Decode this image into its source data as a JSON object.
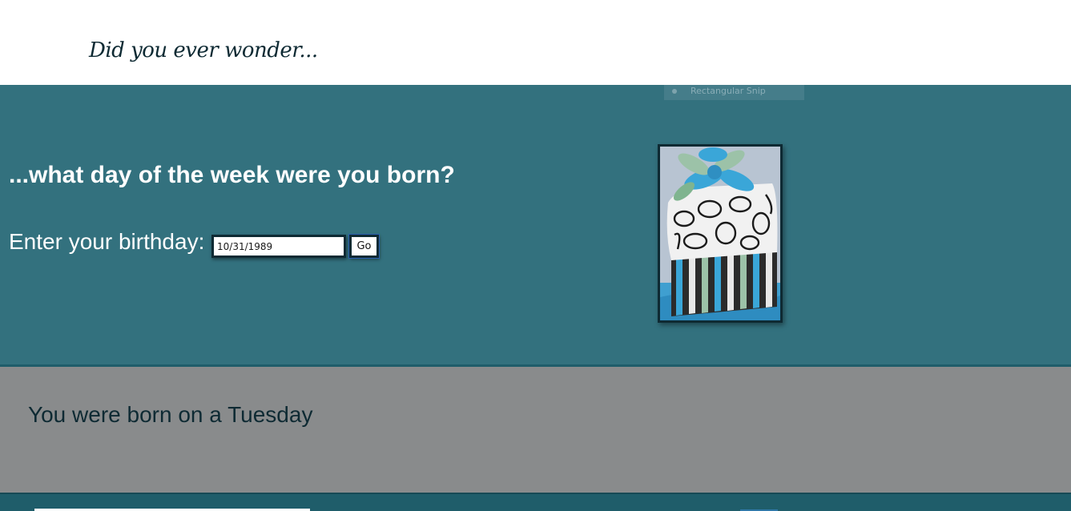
{
  "header": {
    "title": "Did you ever wonder..."
  },
  "overlay": {
    "snip_label": "Rectangular Snip"
  },
  "main": {
    "question": "...what day of the week were you born?",
    "prompt_label": "Enter your birthday:",
    "birthday_value": "10/31/1989",
    "go_label": "Go",
    "image_icon": "birthday-cake-image"
  },
  "result": {
    "text": "You were born on a Tuesday"
  },
  "colors": {
    "header_bg": "#ffffff",
    "main_bg": "#33717e",
    "result_bg": "#898b8c",
    "footer_bg": "#1f5d6a",
    "text_dark": "#0e2a33"
  }
}
